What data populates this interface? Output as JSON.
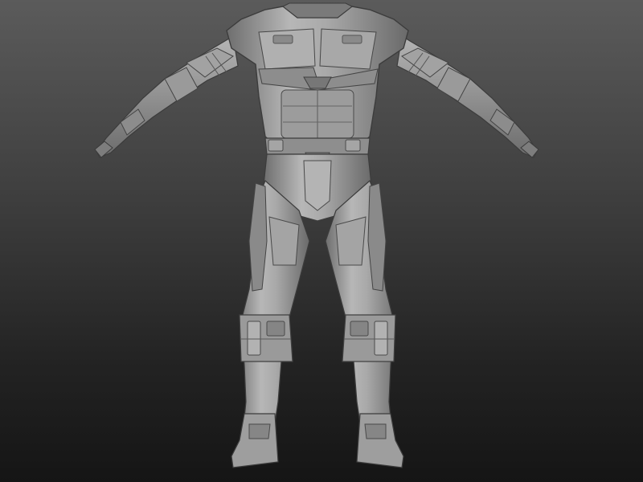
{
  "viewport": {
    "background_top": "#5b5b5b",
    "background_bottom": "#151515"
  },
  "model": {
    "subject": "armored-suit-sculpt",
    "material_light": "#b5b5b5",
    "material_mid": "#8f8f8f",
    "material_dark": "#5f5f5f",
    "edge_color": "#3c3c3c"
  }
}
